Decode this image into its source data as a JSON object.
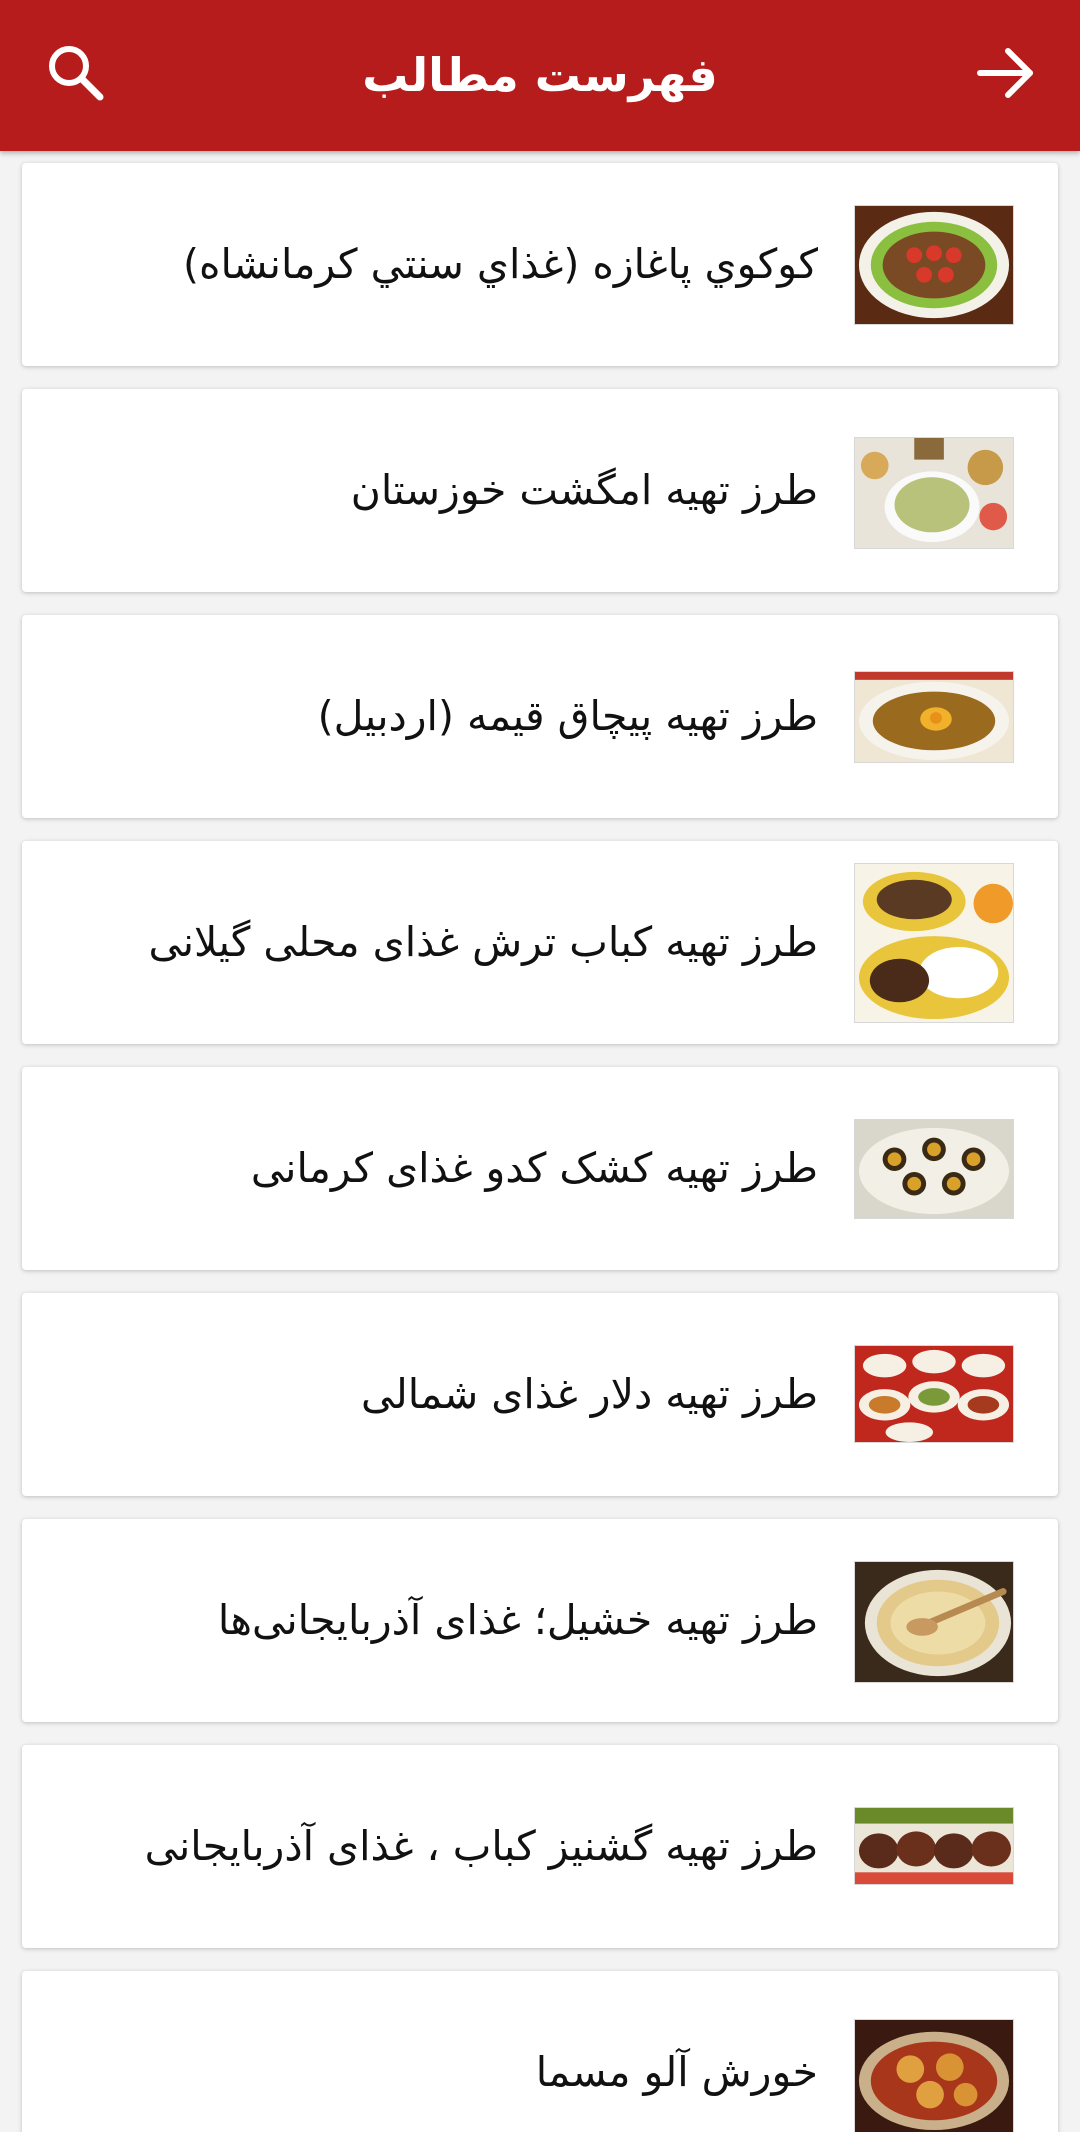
{
  "app_bar": {
    "title": "فهرست مطالب",
    "search_icon": "search-icon",
    "back_icon": "arrow-right-icon",
    "color": "#b71c1c"
  },
  "articles": [
    {
      "title": "كوكوي پاغازه (غذاي سنتي كرمانشاه)",
      "image": "kuku-platter-image"
    },
    {
      "title": "طرز تهیه امگشت خوزستان",
      "image": "rice-dish-image"
    },
    {
      "title": "طرز تهیه پیچاق قیمه (اردبیل)",
      "image": "stew-egg-image"
    },
    {
      "title": "طرز تهیه کباب ترش غذای محلی گیلانی",
      "image": "kabab-rice-image"
    },
    {
      "title": "طرز تهیه کشک کدو غذای کرمانی",
      "image": "kashk-bowl-image"
    },
    {
      "title": "طرز تهیه دلار غذای شمالی",
      "image": "northern-dishes-image"
    },
    {
      "title": "طرز تهیه خشیل؛ غذای آذربایجانی‌ها",
      "image": "porridge-bowl-image"
    },
    {
      "title": "طرز تهیه گشنیز کباب ، غذای آذربایجانی",
      "image": "meatballs-image"
    },
    {
      "title": "خورش آلو مسما",
      "image": "plum-stew-image"
    }
  ]
}
